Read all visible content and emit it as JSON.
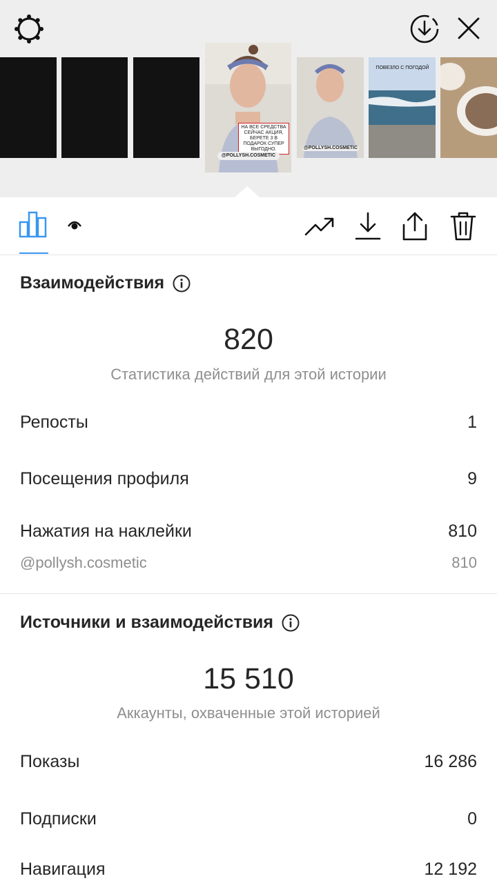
{
  "header": {
    "icons": [
      "settings-icon",
      "download-circle-icon",
      "close-icon"
    ]
  },
  "thumbnails": {
    "selected_caption": "НА ВСЕ СРЕДСТВА СЕЙЧАС АКЦИЯ, БЕРЕТЕ 3 В ПОДАРОК СУПЕР ВЫГОДНО.",
    "selected_tag": "@POLLYSH.COSMETIC",
    "second_tag": "@POLLYSH.COSMETIC",
    "beach_caption": "ПОВЕЗЛО С ПОГОДОЙ"
  },
  "tabs": {
    "icons": [
      "insights-bar-chart-icon",
      "viewers-eye-icon"
    ],
    "actions": [
      "promote-trend-icon",
      "save-download-icon",
      "share-icon",
      "delete-trash-icon"
    ]
  },
  "interactions": {
    "title": "Взаимодействия",
    "total": "820",
    "total_caption": "Статистика действий для этой истории",
    "rows": [
      {
        "label": "Репосты",
        "value": "1"
      },
      {
        "label": "Посещения профиля",
        "value": "9"
      },
      {
        "label": "Нажатия на наклейки",
        "value": "810"
      }
    ],
    "sticker": {
      "label": "@pollysh.cosmetic",
      "value": "810"
    }
  },
  "discovery": {
    "title": "Источники и взаимодействия",
    "total": "15 510",
    "total_caption": "Аккаунты, охваченные этой историей",
    "rows": [
      {
        "label": "Показы",
        "value": "16 286"
      },
      {
        "label": "Подписки",
        "value": "0"
      },
      {
        "label": "Навигация",
        "value": "12 192"
      }
    ]
  },
  "colors": {
    "accent": "#3897f0",
    "text": "#262626",
    "muted": "#8e8e8e",
    "header_bg": "#eeeeee"
  }
}
